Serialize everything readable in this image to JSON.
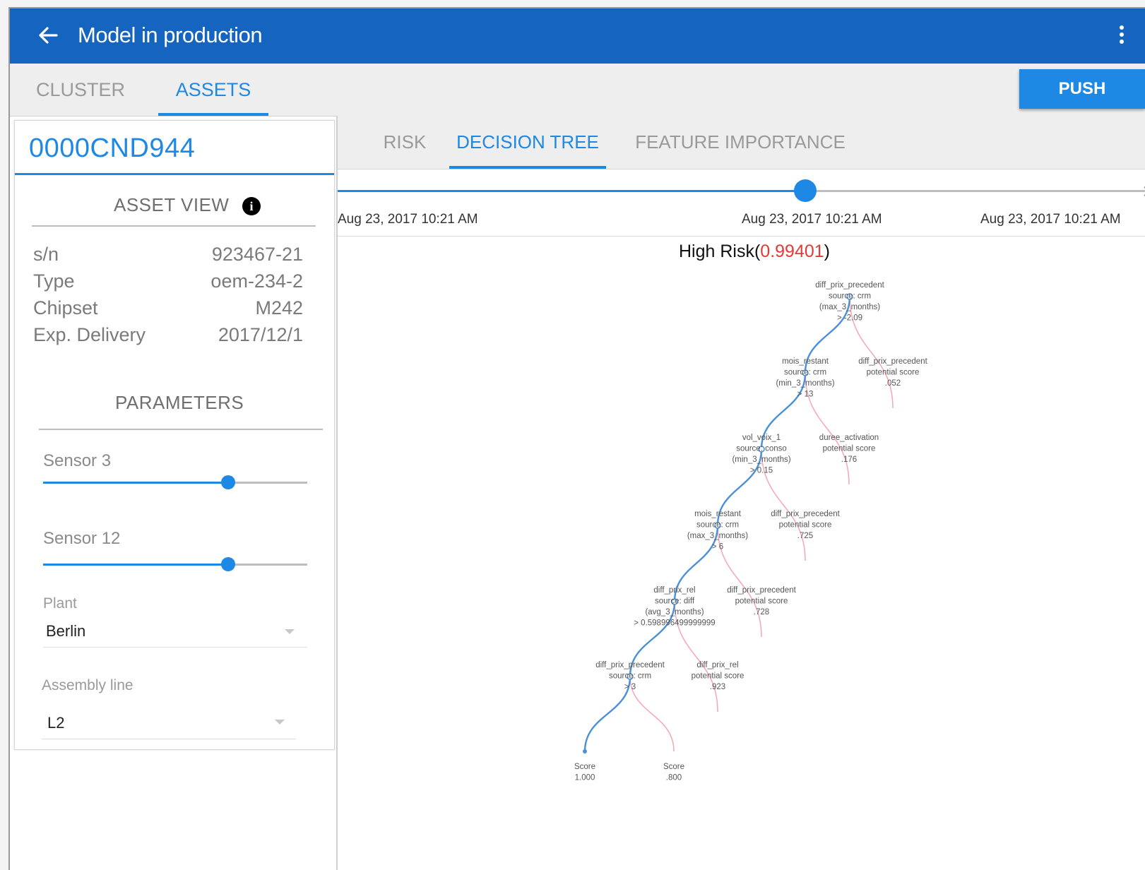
{
  "appbar": {
    "title": "Model in production"
  },
  "tabs": [
    {
      "label": "CLUSTER",
      "active": false
    },
    {
      "label": "ASSETS",
      "active": true
    }
  ],
  "push_label": "PUSH",
  "asset": {
    "id": "0000CND944",
    "view_title": "ASSET VIEW",
    "info_glyph": "i",
    "fields": [
      {
        "label": "s/n",
        "value": "923467-21"
      },
      {
        "label": "Type",
        "value": "oem-234-2"
      },
      {
        "label": "Chipset",
        "value": "M242"
      },
      {
        "label": "Exp. Delivery",
        "value": "2017/12/1"
      }
    ]
  },
  "parameters": {
    "title": "PARAMETERS",
    "sliders": [
      {
        "label": "Sensor 3",
        "value_fraction": 0.7
      },
      {
        "label": "Sensor 12",
        "value_fraction": 0.7
      }
    ],
    "plant": {
      "label": "Plant",
      "value": "Berlin"
    },
    "assembly_line": {
      "label": "Assembly line",
      "value": "L2"
    }
  },
  "subtabs": [
    {
      "label": "RISK",
      "active": false
    },
    {
      "label": "DECISION TREE",
      "active": true
    },
    {
      "label": "FEATURE IMPORTANCE",
      "active": false
    }
  ],
  "timeline": {
    "stamps": [
      "Aug 23, 2017 10:21 AM",
      "Aug 23, 2017 10:21 AM",
      "Aug 23, 2017 10:21 AM"
    ]
  },
  "risk": {
    "prefix": "High Risk(",
    "value": "0.99401",
    "suffix": ")"
  },
  "tree": {
    "nodes": [
      {
        "lines": [
          "diff_prix_precedent",
          "source: crm",
          "(max_3_months)",
          "> -2.09"
        ]
      },
      {
        "lines": [
          "mois_restant",
          "source: crm",
          "(min_3_months)",
          "> 13"
        ]
      },
      {
        "lines": [
          "vol_voix_1",
          "source: conso",
          "(min_3_months)",
          "> 0.15"
        ]
      },
      {
        "lines": [
          "mois_restant",
          "source: crm",
          "(max_3_months)",
          "> 6"
        ]
      },
      {
        "lines": [
          "diff_prix_rel",
          "source: diff",
          "(avg_3_months)",
          "> 0.598996499999999"
        ]
      },
      {
        "lines": [
          "diff_prix_precedent",
          "source: crm",
          "> 3"
        ]
      }
    ],
    "leaves": [
      {
        "lines": [
          "diff_prix_precedent",
          "potential score",
          ".052"
        ]
      },
      {
        "lines": [
          "duree_activation",
          "potential score",
          ".176"
        ]
      },
      {
        "lines": [
          "diff_prix_precedent",
          "potential score",
          ".725"
        ]
      },
      {
        "lines": [
          "diff_prix_precedent",
          "potential score",
          ".728"
        ]
      },
      {
        "lines": [
          "diff_prix_rel",
          "potential score",
          ".923"
        ]
      }
    ],
    "scores": [
      {
        "lines": [
          "Score",
          "1.000"
        ]
      },
      {
        "lines": [
          "Score",
          ".800"
        ]
      }
    ],
    "path_color": "#4a90d9",
    "branch_color": "#f4a7b3"
  }
}
